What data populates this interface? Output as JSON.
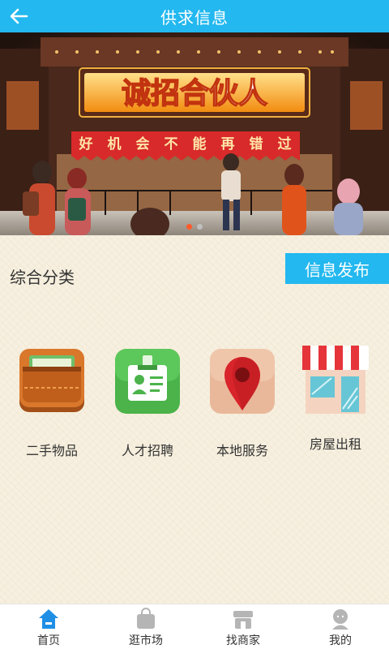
{
  "header": {
    "title": "供求信息",
    "back_icon": "back-arrow-icon"
  },
  "banner": {
    "headline": "诚招合伙人",
    "slogan_chars": [
      "好",
      "机",
      "会",
      "不",
      "能",
      "再",
      "错",
      "过"
    ],
    "dots": {
      "count": 2,
      "active_index": 0
    }
  },
  "section": {
    "title": "综合分类",
    "publish_label": "信息发布"
  },
  "categories": [
    {
      "label": "二手物品",
      "icon": "wallet-icon"
    },
    {
      "label": "人才招聘",
      "icon": "id-badge-icon"
    },
    {
      "label": "本地服务",
      "icon": "location-pin-icon"
    },
    {
      "label": "房屋出租",
      "icon": "storefront-icon"
    }
  ],
  "tabbar": [
    {
      "label": "首页",
      "icon": "home-icon",
      "active": true
    },
    {
      "label": "逛市场",
      "icon": "shopping-bag-icon",
      "active": false
    },
    {
      "label": "找商家",
      "icon": "store-icon",
      "active": false
    },
    {
      "label": "我的",
      "icon": "user-icon",
      "active": false
    }
  ],
  "colors": {
    "accent": "#23b8ef",
    "background": "#f7f0e0",
    "banner_red": "#d82a2a",
    "banner_orange": "#f7a21b"
  }
}
